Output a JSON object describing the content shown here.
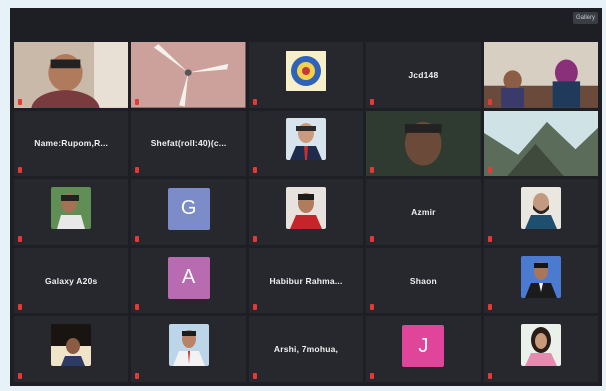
{
  "toolbar": {
    "view_label": "Gallery"
  },
  "participants": [
    {
      "name": "",
      "big": "",
      "type": "video",
      "active": true,
      "label": "",
      "kind": "host-video"
    },
    {
      "name": "",
      "big": "",
      "type": "video",
      "label": "",
      "kind": "fan-video"
    },
    {
      "name": "",
      "big": "",
      "type": "thumb",
      "label": "",
      "kind": "logo"
    },
    {
      "name": "",
      "big": "Jcd148",
      "type": "name",
      "label": ""
    },
    {
      "name": "",
      "big": "",
      "type": "video",
      "label": "",
      "kind": "room-video"
    },
    {
      "name": "",
      "big": "Name:Rupom,R...",
      "type": "name",
      "label": ""
    },
    {
      "name": "",
      "big": "Shefat(roll:40)(c...",
      "type": "name",
      "label": ""
    },
    {
      "name": "",
      "big": "",
      "type": "thumb",
      "label": "",
      "kind": "man-tie"
    },
    {
      "name": "",
      "big": "",
      "type": "video",
      "label": "",
      "kind": "face-dark"
    },
    {
      "name": "",
      "big": "",
      "type": "video",
      "label": "",
      "kind": "tree"
    },
    {
      "name": "",
      "big": "",
      "type": "thumb",
      "label": "",
      "kind": "man-green"
    },
    {
      "name": "",
      "big": "",
      "type": "avatar",
      "letter": "G",
      "color": "#7b8cc8",
      "label": ""
    },
    {
      "name": "",
      "big": "",
      "type": "thumb",
      "label": "",
      "kind": "man-red"
    },
    {
      "name": "",
      "big": "Azmir",
      "type": "name",
      "label": ""
    },
    {
      "name": "",
      "big": "",
      "type": "thumb",
      "label": "",
      "kind": "man-beard"
    },
    {
      "name": "",
      "big": "Galaxy A20s",
      "type": "name",
      "label": ""
    },
    {
      "name": "",
      "big": "",
      "type": "avatar",
      "letter": "A",
      "color": "#b86bb0",
      "label": ""
    },
    {
      "name": "",
      "big": "Habibur  Rahma...",
      "type": "name",
      "label": ""
    },
    {
      "name": "",
      "big": "Shaon",
      "type": "name",
      "label": ""
    },
    {
      "name": "",
      "big": "",
      "type": "thumb",
      "label": "",
      "kind": "man-suit"
    },
    {
      "name": "",
      "big": "",
      "type": "thumb",
      "label": "",
      "kind": "man-dark"
    },
    {
      "name": "",
      "big": "",
      "type": "thumb",
      "label": "",
      "kind": "man-shirt"
    },
    {
      "name": "",
      "big": "Arshi,  7mohua,",
      "type": "name",
      "label": ""
    },
    {
      "name": "",
      "big": "",
      "type": "avatar",
      "letter": "J",
      "color": "#e0459a",
      "label": ""
    },
    {
      "name": "",
      "big": "",
      "type": "thumb",
      "label": "",
      "kind": "woman"
    }
  ]
}
